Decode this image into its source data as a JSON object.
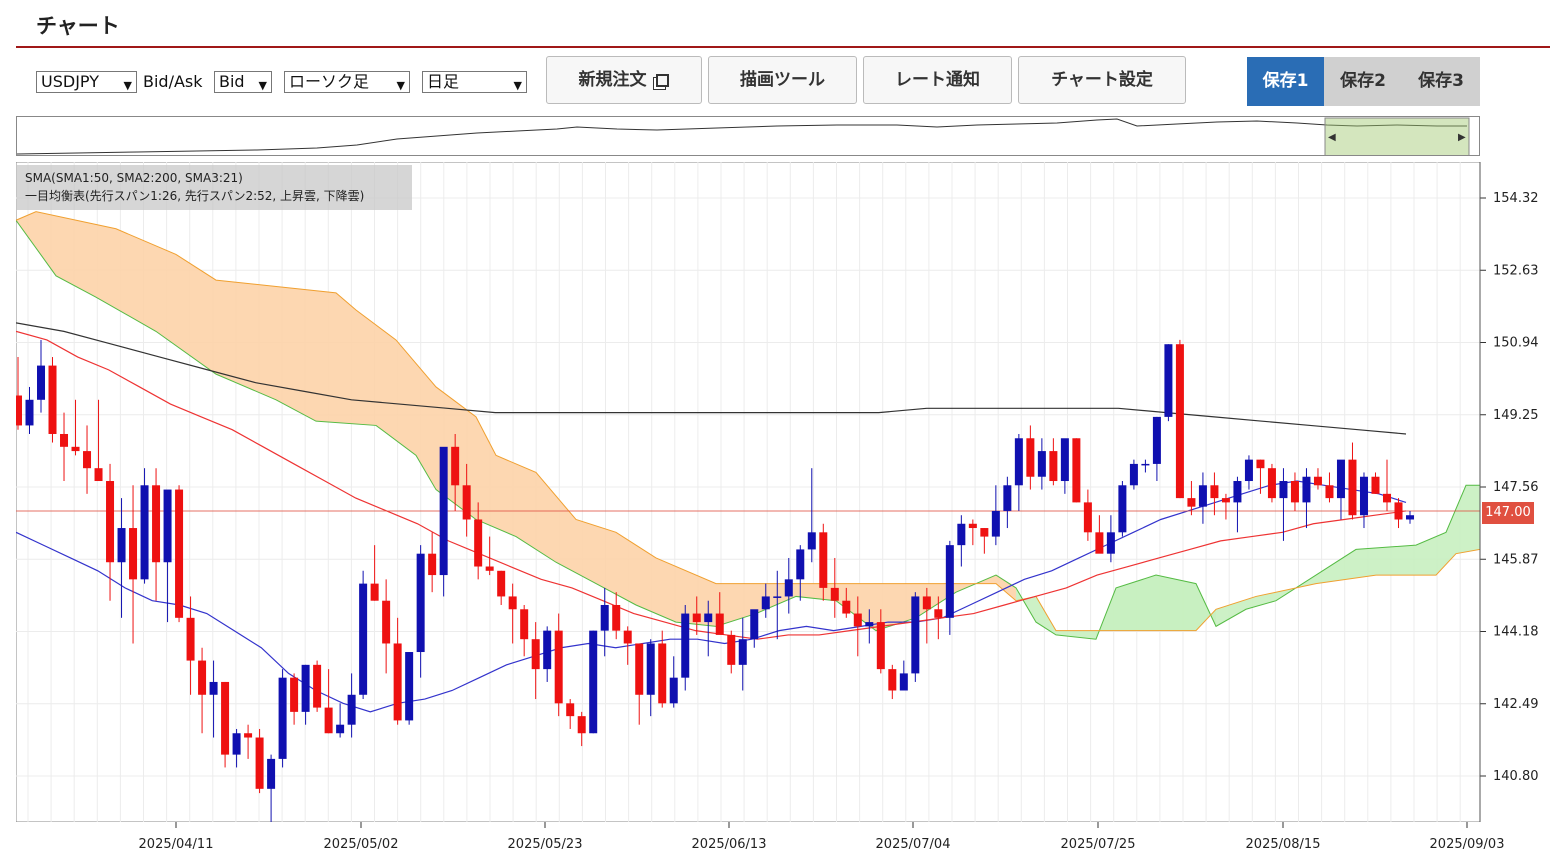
{
  "header": {
    "title": "チャート"
  },
  "toolbar": {
    "symbol": "USDJPY",
    "bidask_label": "Bid/Ask",
    "bidask_value": "Bid",
    "chart_type": "ローソク足",
    "period": "日足",
    "new_order_label": "新規注文",
    "drawing_tools_label": "描画ツール",
    "rate_alert_label": "レート通知",
    "chart_settings_label": "チャート設定",
    "save_tabs": [
      "保存1",
      "保存2",
      "保存3"
    ]
  },
  "legend": {
    "line1": "SMA(SMA1:50, SMA2:200, SMA3:21)",
    "line2": "一目均衡表(先行スパン1:26, 先行スパン2:52, 上昇雲, 下降雲)"
  },
  "colors": {
    "up": "#1010b0",
    "down": "#ee1111",
    "accent": "#a01818",
    "save_active": "#2a6db5",
    "cloud_down": "#fdd3a8",
    "cloud_up": "#c8f0c0",
    "sma_long": "#333333",
    "sma_mid": "#ee3333",
    "sma_short": "#3333cc"
  },
  "chart_data": {
    "type": "candlestick",
    "y_ticks": [
      154.32,
      152.63,
      150.94,
      149.25,
      147.56,
      145.87,
      144.18,
      142.49,
      140.8
    ],
    "y_tick_labels": [
      "154.32",
      "152.63",
      "150.94",
      "149.25",
      "147.56",
      "145.87",
      "144.18",
      "142.49",
      "140.80"
    ],
    "ylim": [
      140.0,
      155.0
    ],
    "x_tick_labels": [
      "2025/04/11",
      "2025/05/02",
      "2025/05/23",
      "2025/06/13",
      "2025/07/04",
      "2025/07/25",
      "2025/08/15",
      "2025/09/03"
    ],
    "current_price": "147.00",
    "current_value": 147.0,
    "candles": [
      [
        149.7,
        150.6,
        148.9,
        149.0
      ],
      [
        149.0,
        149.9,
        148.8,
        149.6
      ],
      [
        149.6,
        151.0,
        149.3,
        150.4
      ],
      [
        150.4,
        150.6,
        148.6,
        148.8
      ],
      [
        148.8,
        149.3,
        147.7,
        148.5
      ],
      [
        148.5,
        149.6,
        148.3,
        148.4
      ],
      [
        148.4,
        149.0,
        147.4,
        148.0
      ],
      [
        148.0,
        149.6,
        147.9,
        147.7
      ],
      [
        147.7,
        148.1,
        144.9,
        145.8
      ],
      [
        145.8,
        147.3,
        144.5,
        146.6
      ],
      [
        146.6,
        147.6,
        143.9,
        145.4
      ],
      [
        145.4,
        148.0,
        145.3,
        147.6
      ],
      [
        147.6,
        148.0,
        144.9,
        145.8
      ],
      [
        145.8,
        147.3,
        144.4,
        147.5
      ],
      [
        147.5,
        147.6,
        144.4,
        144.5
      ],
      [
        144.5,
        145.0,
        142.7,
        143.5
      ],
      [
        143.5,
        143.8,
        141.8,
        142.7
      ],
      [
        142.7,
        143.5,
        141.7,
        143.0
      ],
      [
        143.0,
        143.0,
        141.0,
        141.3
      ],
      [
        141.3,
        141.9,
        141.0,
        141.8
      ],
      [
        141.8,
        142.0,
        141.2,
        141.7
      ],
      [
        141.7,
        141.9,
        140.4,
        140.5
      ],
      [
        140.5,
        141.3,
        139.6,
        141.2
      ],
      [
        141.2,
        143.3,
        141.0,
        143.1
      ],
      [
        143.1,
        143.2,
        142.0,
        142.3
      ],
      [
        142.3,
        143.4,
        142.0,
        143.4
      ],
      [
        143.4,
        143.5,
        142.3,
        142.4
      ],
      [
        142.4,
        143.3,
        141.8,
        141.8
      ],
      [
        141.8,
        142.5,
        141.7,
        142.0
      ],
      [
        142.0,
        143.2,
        141.7,
        142.7
      ],
      [
        142.7,
        145.6,
        142.6,
        145.3
      ],
      [
        145.3,
        146.2,
        144.9,
        144.9
      ],
      [
        144.9,
        145.4,
        143.2,
        143.9
      ],
      [
        143.9,
        144.5,
        142.0,
        142.1
      ],
      [
        142.1,
        143.7,
        142.0,
        143.7
      ],
      [
        143.7,
        146.2,
        143.1,
        146.0
      ],
      [
        146.0,
        146.5,
        145.1,
        145.5
      ],
      [
        145.5,
        146.3,
        145.0,
        148.5
      ],
      [
        148.5,
        148.8,
        147.0,
        147.6
      ],
      [
        147.6,
        148.1,
        146.4,
        146.8
      ],
      [
        146.8,
        147.2,
        145.4,
        145.7
      ],
      [
        145.7,
        146.4,
        145.5,
        145.6
      ],
      [
        145.6,
        145.6,
        144.8,
        145.0
      ],
      [
        145.0,
        145.3,
        143.9,
        144.7
      ],
      [
        144.7,
        144.8,
        143.6,
        144.0
      ],
      [
        144.0,
        144.4,
        142.6,
        143.3
      ],
      [
        143.3,
        144.3,
        143.0,
        144.2
      ],
      [
        144.2,
        144.6,
        142.2,
        142.5
      ],
      [
        142.5,
        142.6,
        141.9,
        142.2
      ],
      [
        142.2,
        142.3,
        141.5,
        141.8
      ],
      [
        141.8,
        144.2,
        141.8,
        144.2
      ],
      [
        144.2,
        145.2,
        143.6,
        144.8
      ],
      [
        144.8,
        145.1,
        144.0,
        144.2
      ],
      [
        144.2,
        144.3,
        143.4,
        143.9
      ],
      [
        143.9,
        143.9,
        142.0,
        142.7
      ],
      [
        142.7,
        144.0,
        142.2,
        143.9
      ],
      [
        143.9,
        144.2,
        142.4,
        142.5
      ],
      [
        142.5,
        143.6,
        142.4,
        143.1
      ],
      [
        143.1,
        144.8,
        142.8,
        144.6
      ],
      [
        144.6,
        145.0,
        144.1,
        144.4
      ],
      [
        144.4,
        144.9,
        143.6,
        144.6
      ],
      [
        144.6,
        145.1,
        144.3,
        144.1
      ],
      [
        144.1,
        144.2,
        143.2,
        143.4
      ],
      [
        143.4,
        144.5,
        142.8,
        144.0
      ],
      [
        144.0,
        144.6,
        143.8,
        144.7
      ],
      [
        144.7,
        145.3,
        144.5,
        145.0
      ],
      [
        145.0,
        145.6,
        144.0,
        145.0
      ],
      [
        145.0,
        145.9,
        144.6,
        145.4
      ],
      [
        145.4,
        146.2,
        144.9,
        146.1
      ],
      [
        146.1,
        148.0,
        145.8,
        146.5
      ],
      [
        146.5,
        146.7,
        144.9,
        145.2
      ],
      [
        145.2,
        145.9,
        144.5,
        144.9
      ],
      [
        144.9,
        145.2,
        144.5,
        144.6
      ],
      [
        144.6,
        145.0,
        143.6,
        144.3
      ],
      [
        144.3,
        144.7,
        143.9,
        144.4
      ],
      [
        144.4,
        144.7,
        143.2,
        143.3
      ],
      [
        143.3,
        143.4,
        142.6,
        142.8
      ],
      [
        142.8,
        143.5,
        142.9,
        143.2
      ],
      [
        143.2,
        145.1,
        143.0,
        145.0
      ],
      [
        145.0,
        145.2,
        143.9,
        144.7
      ],
      [
        144.7,
        145.0,
        144.0,
        144.5
      ],
      [
        144.5,
        146.3,
        144.1,
        146.2
      ],
      [
        146.2,
        146.9,
        145.7,
        146.7
      ],
      [
        146.7,
        146.8,
        146.2,
        146.6
      ],
      [
        146.6,
        146.6,
        146.0,
        146.4
      ],
      [
        146.4,
        147.6,
        146.2,
        147.0
      ],
      [
        147.0,
        147.8,
        146.6,
        147.6
      ],
      [
        147.6,
        148.8,
        147.0,
        148.7
      ],
      [
        148.7,
        149.0,
        147.5,
        147.8
      ],
      [
        147.8,
        148.7,
        147.5,
        148.4
      ],
      [
        148.4,
        148.7,
        147.6,
        147.7
      ],
      [
        147.7,
        148.5,
        147.4,
        148.7
      ],
      [
        148.7,
        148.7,
        147.2,
        147.2
      ],
      [
        147.2,
        147.5,
        146.3,
        146.5
      ],
      [
        146.5,
        146.9,
        146.2,
        146.0
      ],
      [
        146.0,
        146.9,
        145.8,
        146.5
      ],
      [
        146.5,
        147.7,
        146.4,
        147.6
      ],
      [
        147.6,
        148.2,
        147.5,
        148.1
      ],
      [
        148.1,
        148.2,
        147.9,
        148.1
      ],
      [
        148.1,
        149.2,
        147.7,
        149.2
      ],
      [
        149.2,
        150.9,
        149.1,
        150.9
      ],
      [
        150.9,
        151.0,
        147.3,
        147.3
      ],
      [
        147.3,
        147.7,
        146.9,
        147.1
      ],
      [
        147.1,
        147.9,
        146.7,
        147.6
      ],
      [
        147.6,
        147.9,
        146.9,
        147.3
      ],
      [
        147.3,
        147.4,
        146.8,
        147.2
      ],
      [
        147.2,
        147.8,
        146.5,
        147.7
      ],
      [
        147.7,
        148.3,
        147.5,
        148.2
      ],
      [
        148.2,
        148.2,
        147.4,
        148.0
      ],
      [
        148.0,
        148.1,
        147.2,
        147.3
      ],
      [
        147.3,
        148.0,
        146.3,
        147.7
      ],
      [
        147.7,
        147.9,
        147.0,
        147.2
      ],
      [
        147.2,
        148.0,
        146.6,
        147.8
      ],
      [
        147.8,
        148.0,
        147.5,
        147.6
      ],
      [
        147.6,
        147.9,
        147.2,
        147.3
      ],
      [
        147.3,
        148.0,
        146.8,
        148.2
      ],
      [
        148.2,
        148.6,
        146.8,
        146.9
      ],
      [
        146.9,
        147.9,
        146.6,
        147.8
      ],
      [
        147.8,
        147.9,
        147.4,
        147.4
      ],
      [
        147.4,
        148.2,
        147.0,
        147.2
      ],
      [
        147.2,
        147.3,
        146.6,
        146.8
      ],
      [
        146.8,
        147.0,
        146.7,
        146.9
      ]
    ],
    "series": [
      {
        "name": "SMA1",
        "values": [
          146.5,
          146.2,
          145.9,
          145.6,
          145.2,
          144.9,
          144.8,
          144.6,
          144.2,
          143.8,
          143.2,
          142.8,
          142.5,
          142.3,
          142.5,
          142.6,
          142.8,
          143.1,
          143.4,
          143.6,
          143.8,
          143.9,
          143.8,
          143.9,
          144.0,
          144.0,
          143.9,
          144.0,
          144.2,
          144.3,
          144.2,
          144.3,
          144.4,
          144.4,
          144.5,
          144.8,
          145.1,
          145.4,
          145.6,
          145.9,
          146.2,
          146.5,
          146.8,
          147.0,
          147.2,
          147.4,
          147.6,
          147.7,
          147.6,
          147.5,
          147.4,
          147.2
        ]
      },
      {
        "name": "SMA2",
        "values": [
          151.2,
          151.0,
          150.6,
          150.3,
          149.9,
          149.5,
          149.2,
          148.9,
          148.5,
          148.1,
          147.7,
          147.3,
          147.0,
          146.7,
          146.3,
          146.0,
          145.7,
          145.4,
          145.2,
          144.9,
          144.6,
          144.4,
          144.2,
          144.1,
          144.0,
          144.1,
          144.1,
          144.2,
          144.3,
          144.4,
          144.5,
          144.6,
          144.8,
          145.0,
          145.2,
          145.5,
          145.7,
          145.9,
          146.1,
          146.3,
          146.4,
          146.5,
          146.7,
          146.8,
          146.9,
          147.0
        ]
      },
      {
        "name": "SMA3",
        "values": [
          151.4,
          151.2,
          150.9,
          150.6,
          150.3,
          150.0,
          149.8,
          149.6,
          149.5,
          149.4,
          149.3,
          149.3,
          149.3,
          149.3,
          149.3,
          149.3,
          149.3,
          149.3,
          149.3,
          149.4,
          149.4,
          149.4,
          149.4,
          149.4,
          149.3,
          149.2,
          149.1,
          149.0,
          148.9,
          148.8
        ]
      }
    ]
  }
}
